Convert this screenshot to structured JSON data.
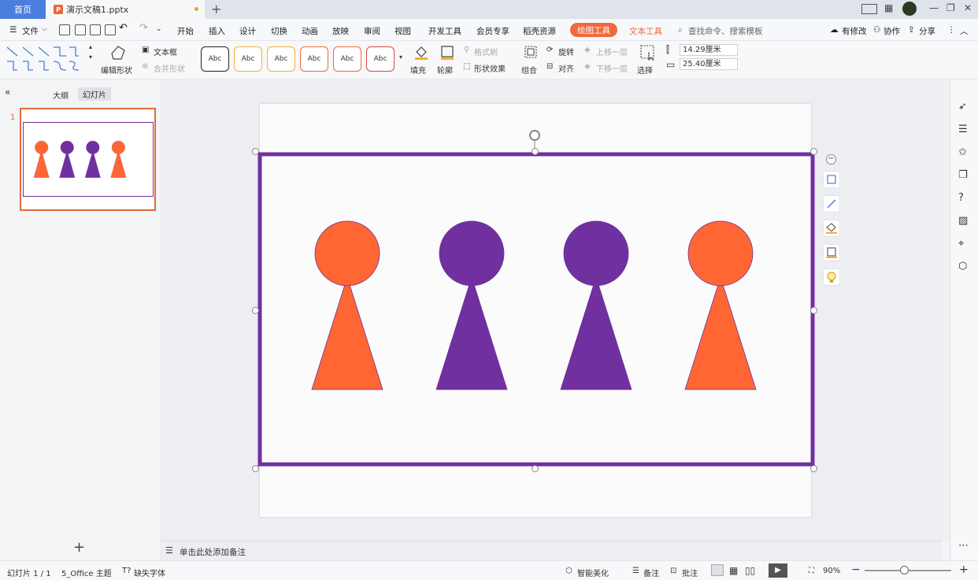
{
  "tabs": {
    "home": "首页",
    "document": "演示文稿1.pptx",
    "new_tab": "+"
  },
  "menu": {
    "file": "文件",
    "items": [
      "开始",
      "插入",
      "设计",
      "切换",
      "动画",
      "放映",
      "审阅",
      "视图",
      "开发工具",
      "会员专享",
      "稻壳资源"
    ],
    "drawing_tools": "绘图工具",
    "text_tools": "文本工具",
    "search_placeholder": "查找命令、搜索模板",
    "has_changes": "有修改",
    "collaborate": "协作",
    "share": "分享"
  },
  "ribbon": {
    "edit_shape": "编辑形状",
    "text_box": "文本框",
    "merge_shape": "合并形状",
    "style_sample": "Abc",
    "style_colors": [
      "#222222",
      "#f5b030",
      "#f5b030",
      "#ee6a3d",
      "#ee6a3d",
      "#e64040"
    ],
    "fill": "填充",
    "outline": "轮廓",
    "format_painter": "格式刷",
    "shape_effect": "形状效果",
    "group": "组合",
    "rotate": "旋转",
    "align": "对齐",
    "bring_forward": "上移一层",
    "send_backward": "下移一层",
    "select": "选择",
    "height": "14.29厘米",
    "width": "25.40厘米"
  },
  "left_pane": {
    "outline_tab": "大纲",
    "slides_tab": "幻灯片",
    "slide_number": "1",
    "add_slide": "+"
  },
  "notes_placeholder": "单击此处添加备注",
  "status": {
    "slide_counter": "幻灯片 1 / 1",
    "theme": "5_Office 主题",
    "missing_font": "缺失字体",
    "smart_beautify": "智能美化",
    "notes": "备注",
    "comments": "批注",
    "zoom": "90%"
  },
  "colors": {
    "orange": "#ff6633",
    "purple": "#7030a0",
    "accent": "#ee6a3d"
  },
  "slide": {
    "figures": [
      {
        "color": "orange"
      },
      {
        "color": "purple"
      },
      {
        "color": "purple"
      },
      {
        "color": "orange"
      }
    ]
  }
}
